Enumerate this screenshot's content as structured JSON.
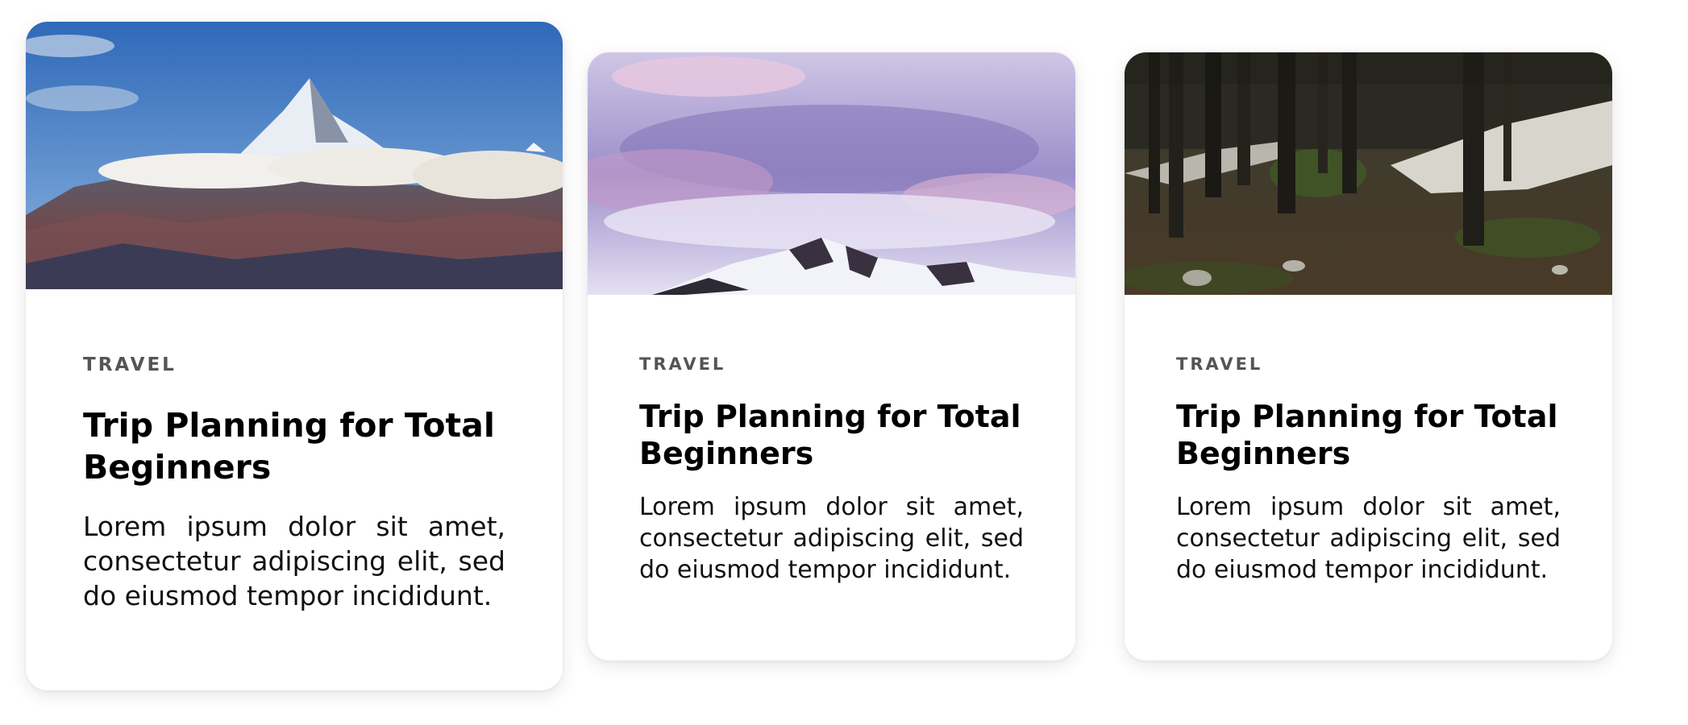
{
  "cards": [
    {
      "image": "mountain-peak-above-clouds",
      "category": "TRAVEL",
      "title": "Trip Planning for Total Beginners",
      "description": "Lorem ipsum dolor sit amet, consectetur adipiscing elit, sed do eiusmod tempor incididunt."
    },
    {
      "image": "snowy-ridge-under-purple-clouds",
      "category": "TRAVEL",
      "title": "Trip Planning for Total Beginners",
      "description": "Lorem ipsum dolor sit amet, consectetur adipiscing elit, sed do eiusmod tempor incididunt."
    },
    {
      "image": "forest-with-snow-patches",
      "category": "TRAVEL",
      "title": "Trip Planning for Total Beginners",
      "description": "Lorem ipsum dolor sit amet, consectetur adipiscing elit, sed do eiusmod tempor incididunt."
    }
  ],
  "colors": {
    "card_background": "#ffffff",
    "category_text": "#555555",
    "title_text": "#000000",
    "body_text": "#111111"
  }
}
